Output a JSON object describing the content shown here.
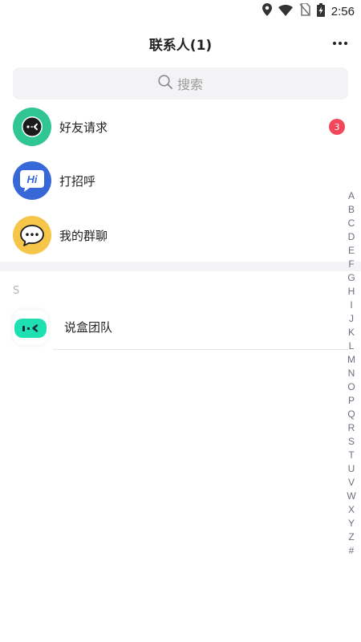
{
  "status_bar": {
    "time": "2:56",
    "icons": [
      "location-icon",
      "wifi-icon",
      "no-sim-icon",
      "battery-charging-icon"
    ]
  },
  "header": {
    "title": "联系人(1)",
    "more_icon": "more-dots-icon"
  },
  "search": {
    "placeholder": "搜索",
    "icon": "search-icon"
  },
  "functions": [
    {
      "label": "好友请求",
      "icon": "friend-request-icon",
      "color": "#2fc694",
      "badge": "3"
    },
    {
      "label": "打招呼",
      "icon": "hi-icon",
      "color": "#3868d8",
      "avatar_text": "Hi"
    },
    {
      "label": "我的群聊",
      "icon": "group-chat-icon",
      "color": "#f5c64a"
    }
  ],
  "sections": [
    {
      "letter": "S",
      "contacts": [
        {
          "name": "说盒团队",
          "avatar_icon": "shuohe-logo-icon",
          "color": "#1fe0b0"
        }
      ]
    }
  ],
  "alphabet": [
    "A",
    "B",
    "C",
    "D",
    "E",
    "F",
    "G",
    "H",
    "I",
    "J",
    "K",
    "L",
    "M",
    "N",
    "O",
    "P",
    "Q",
    "R",
    "S",
    "T",
    "U",
    "V",
    "W",
    "X",
    "Y",
    "Z",
    "#"
  ],
  "colors": {
    "badge": "#f3465a",
    "index_text": "#6d6d80"
  }
}
